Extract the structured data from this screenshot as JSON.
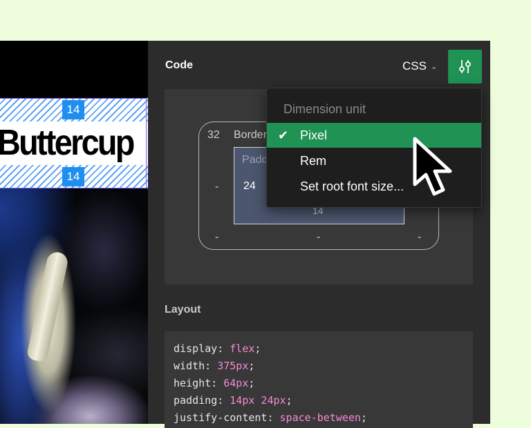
{
  "preview": {
    "headline": "Buttercup",
    "padding_top_badge": "14",
    "padding_bottom_badge": "14"
  },
  "code_panel": {
    "title": "Code",
    "language": "CSS",
    "settings_icon": "sliders-icon",
    "accent_color": "#1f9254",
    "box_model": {
      "border_label": "Border",
      "border_values": {
        "top": "32",
        "left": "-",
        "right": "-",
        "bottom_left": "-",
        "bottom": "-",
        "bottom_right": "-"
      },
      "padding_label": "Padding",
      "padding_values": {
        "left": "24",
        "bottom": "14"
      }
    },
    "dimension_menu": {
      "header": "Dimension unit",
      "items": [
        {
          "label": "Pixel",
          "selected": true
        },
        {
          "label": "Rem",
          "selected": false
        },
        {
          "label": "Set root font size...",
          "selected": false
        }
      ]
    },
    "layout": {
      "title": "Layout",
      "lines": [
        {
          "prop": "display",
          "value": "flex"
        },
        {
          "prop": "width",
          "value": "375px"
        },
        {
          "prop": "height",
          "value": "64px"
        },
        {
          "prop": "padding",
          "value": "14px 24px"
        },
        {
          "prop": "justify-content",
          "value": "space-between"
        }
      ]
    }
  }
}
